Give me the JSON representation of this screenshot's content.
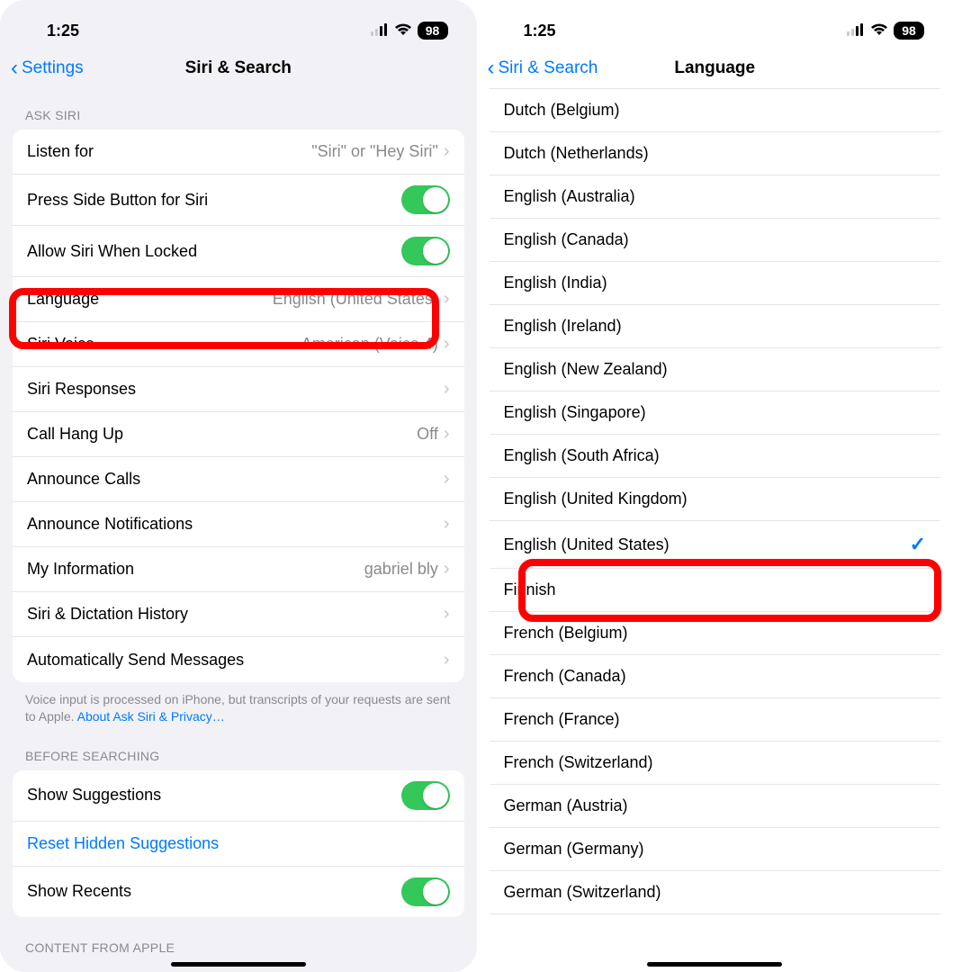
{
  "status": {
    "time": "1:25",
    "battery": "98"
  },
  "left": {
    "back": "Settings",
    "title": "Siri & Search",
    "section_ask": "ASK SIRI",
    "rows": {
      "listen": {
        "label": "Listen for",
        "value": "\"Siri\" or \"Hey Siri\""
      },
      "press": {
        "label": "Press Side Button for Siri"
      },
      "locked": {
        "label": "Allow Siri When Locked"
      },
      "language": {
        "label": "Language",
        "value": "English (United States)"
      },
      "voice": {
        "label": "Siri Voice",
        "value": "American (Voice 4)"
      },
      "responses": {
        "label": "Siri Responses"
      },
      "hangup": {
        "label": "Call Hang Up",
        "value": "Off"
      },
      "announce_calls": {
        "label": "Announce Calls"
      },
      "announce_notifs": {
        "label": "Announce Notifications"
      },
      "myinfo": {
        "label": "My Information",
        "value": "gabriel bly"
      },
      "history": {
        "label": "Siri & Dictation History"
      },
      "autosend": {
        "label": "Automatically Send Messages"
      }
    },
    "footer": "Voice input is processed on iPhone, but transcripts of your requests are sent to Apple. ",
    "footer_link": "About Ask Siri & Privacy…",
    "section_before": "BEFORE SEARCHING",
    "suggestions": {
      "show": "Show Suggestions",
      "reset": "Reset Hidden Suggestions",
      "recents": "Show Recents"
    },
    "section_content": "CONTENT FROM APPLE"
  },
  "right": {
    "back": "Siri & Search",
    "title": "Language",
    "languages": [
      {
        "label": "Dutch (Belgium)"
      },
      {
        "label": "Dutch (Netherlands)"
      },
      {
        "label": "English (Australia)"
      },
      {
        "label": "English (Canada)"
      },
      {
        "label": "English (India)"
      },
      {
        "label": "English (Ireland)"
      },
      {
        "label": "English (New Zealand)"
      },
      {
        "label": "English (Singapore)"
      },
      {
        "label": "English (South Africa)"
      },
      {
        "label": "English (United Kingdom)"
      },
      {
        "label": "English (United States)",
        "selected": true
      },
      {
        "label": "Finnish"
      },
      {
        "label": "French (Belgium)"
      },
      {
        "label": "French (Canada)"
      },
      {
        "label": "French (France)"
      },
      {
        "label": "French (Switzerland)"
      },
      {
        "label": "German (Austria)"
      },
      {
        "label": "German (Germany)"
      },
      {
        "label": "German (Switzerland)"
      }
    ]
  }
}
